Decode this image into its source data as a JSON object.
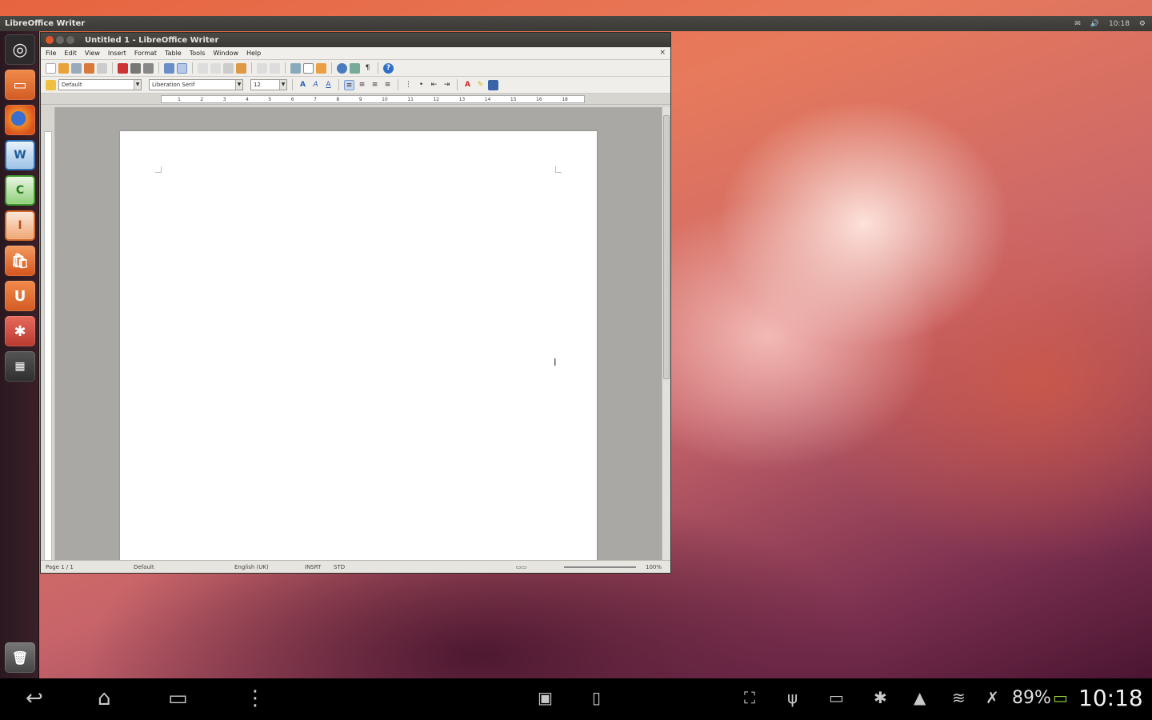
{
  "top_panel": {
    "app_name": "LibreOffice Writer",
    "time": "10:18"
  },
  "window": {
    "title": "Untitled 1 - LibreOffice Writer",
    "menus": [
      "File",
      "Edit",
      "View",
      "Insert",
      "Format",
      "Table",
      "Tools",
      "Window",
      "Help"
    ],
    "paragraph_style": "Default",
    "font_name": "Liberation Serif",
    "font_size": "12",
    "ruler_numbers": [
      "1",
      "2",
      "3",
      "4",
      "5",
      "6",
      "7",
      "8",
      "9",
      "10",
      "11",
      "12",
      "13",
      "14",
      "15",
      "16",
      "18"
    ]
  },
  "statusbar": {
    "page": "Page 1 / 1",
    "style": "Default",
    "language": "English (UK)",
    "insert_mode": "INSRT",
    "selection_mode": "STD",
    "zoom": "100%"
  },
  "launcher": {
    "items": [
      "dash",
      "files",
      "firefox",
      "writer",
      "calc",
      "impress",
      "software-center",
      "ubuntu-one",
      "system-settings",
      "workspaces",
      "trash"
    ]
  },
  "navbar": {
    "battery": "89%",
    "clock": "10:18"
  },
  "colors": {
    "accent_orange": "#e5542b",
    "panel_dark": "#3b3a36"
  }
}
